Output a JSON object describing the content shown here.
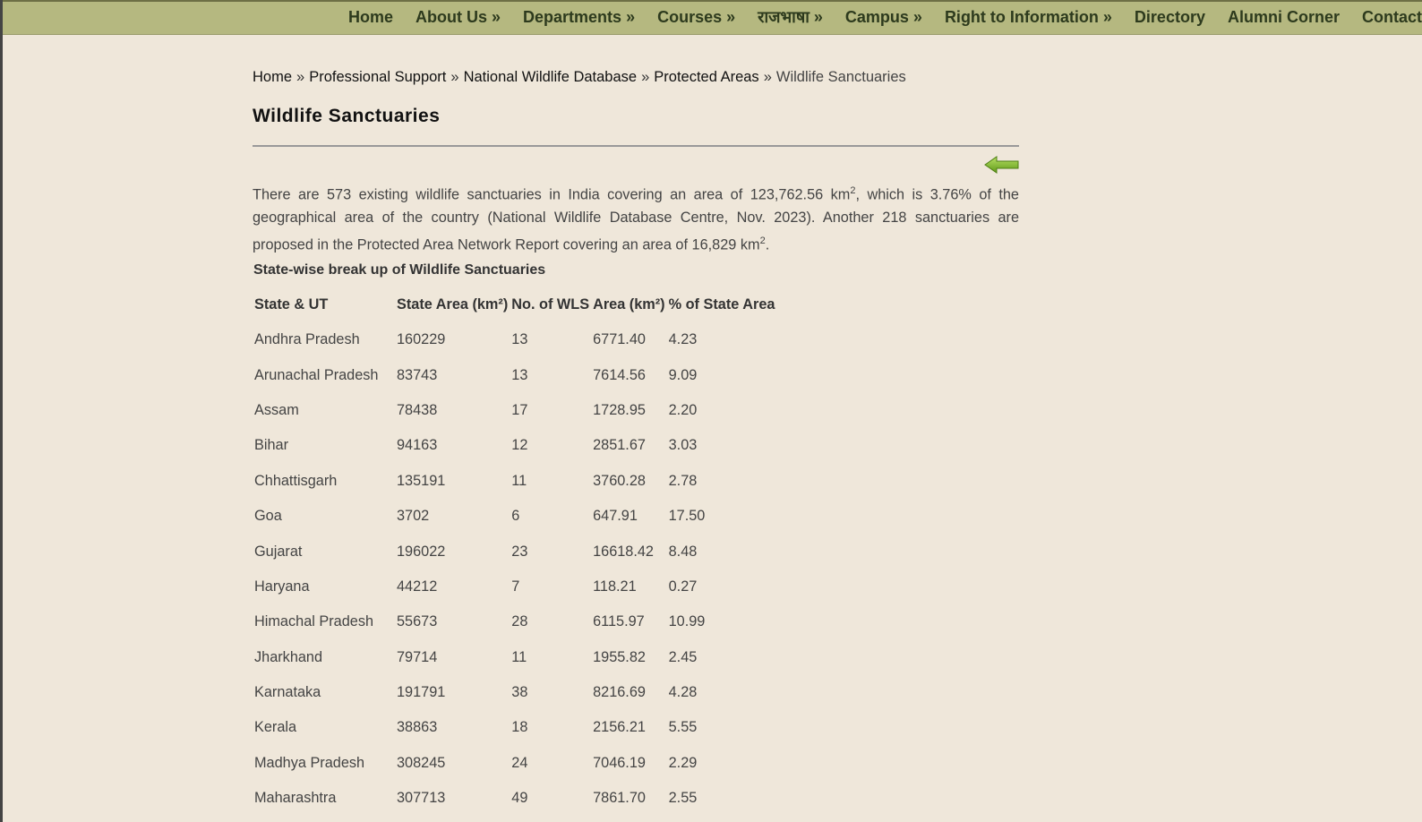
{
  "nav": {
    "items": [
      "Home",
      "About Us »",
      "Departments »",
      "Courses »",
      "राजभाषा »",
      "Campus »",
      "Right to Information »",
      "Directory",
      "Alumni Corner",
      "Contact Us"
    ]
  },
  "breadcrumb": {
    "items": [
      "Home",
      "Professional Support",
      "National Wildlife Database",
      "Protected Areas"
    ],
    "separator": "»",
    "current": "Wildlife Sanctuaries"
  },
  "page": {
    "title": "Wildlife Sanctuaries",
    "intro_part1": "There are 573 existing wildlife sanctuaries in India covering an area of 123,762.56 km",
    "intro_sup1": "2",
    "intro_part2": ", which is 3.76% of the geographical area of the country (National Wildlife Database Centre, Nov. 2023).  Another 218 sanctuaries are proposed in the Protected Area Network Report covering an area of 16,829 km",
    "intro_sup2": "2",
    "intro_part3": ".",
    "section_title": "State-wise break up of Wildlife Sanctuaries"
  },
  "table": {
    "headers": [
      "State & UT",
      "State Area (km²)",
      "No. of WLS",
      "Area (km²)",
      "% of State Area"
    ],
    "rows": [
      [
        "Andhra Pradesh",
        "160229",
        "13",
        "6771.40",
        "4.23"
      ],
      [
        "Arunachal Pradesh",
        "83743",
        "13",
        "7614.56",
        "9.09"
      ],
      [
        "Assam",
        "78438",
        "17",
        "1728.95",
        "2.20"
      ],
      [
        "Bihar",
        "94163",
        "12",
        "2851.67",
        "3.03"
      ],
      [
        "Chhattisgarh",
        "135191",
        "11",
        "3760.28",
        "2.78"
      ],
      [
        "Goa",
        "3702",
        "6",
        "647.91",
        "17.50"
      ],
      [
        "Gujarat",
        "196022",
        "23",
        "16618.42",
        "8.48"
      ],
      [
        "Haryana",
        "44212",
        "7",
        "118.21",
        "0.27"
      ],
      [
        "Himachal Pradesh",
        "55673",
        "28",
        "6115.97",
        "10.99"
      ],
      [
        "Jharkhand",
        "79714",
        "11",
        "1955.82",
        "2.45"
      ],
      [
        "Karnataka",
        "191791",
        "38",
        "8216.69",
        "4.28"
      ],
      [
        "Kerala",
        "38863",
        "18",
        "2156.21",
        "5.55"
      ],
      [
        "Madhya Pradesh",
        "308245",
        "24",
        "7046.19",
        "2.29"
      ],
      [
        "Maharashtra",
        "307713",
        "49",
        "7861.70",
        "2.55"
      ]
    ]
  },
  "icons": {
    "back": "back-arrow-icon"
  },
  "colors": {
    "navbar": "#b5b880",
    "nav_text": "#2d3a1d",
    "background": "#efe7da",
    "arrow": "#7cb52a"
  }
}
